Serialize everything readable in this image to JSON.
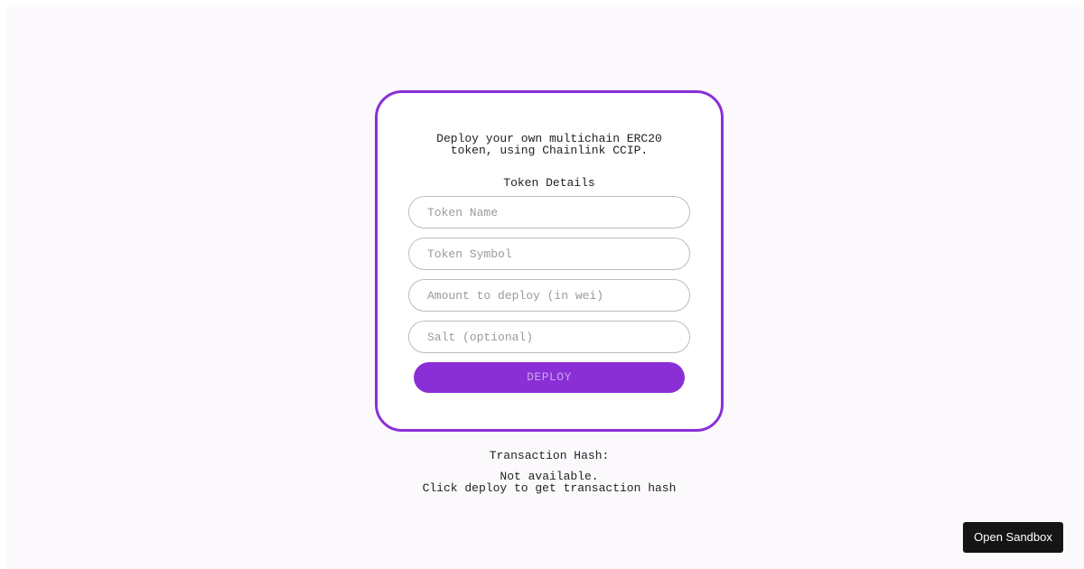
{
  "form": {
    "intro_line1": "Deploy your own multichain ERC20",
    "intro_line2": "token, using Chainlink CCIP.",
    "section_title": "Token Details",
    "token_name": {
      "value": "",
      "placeholder": "Token Name"
    },
    "token_symbol": {
      "value": "",
      "placeholder": "Token Symbol"
    },
    "amount": {
      "value": "",
      "placeholder": "Amount to deploy (in wei)"
    },
    "salt": {
      "value": "",
      "placeholder": "Salt (optional)"
    },
    "deploy_label": "DEPLOY"
  },
  "transaction": {
    "label": "Transaction Hash:",
    "status_line1": "Not available.",
    "status_line2": "Click deploy to get transaction hash"
  },
  "sandbox": {
    "label": "Open Sandbox"
  },
  "colors": {
    "accent": "#8a2fd6",
    "background": "#fcf9fd",
    "sandbox_button": "#151515"
  }
}
